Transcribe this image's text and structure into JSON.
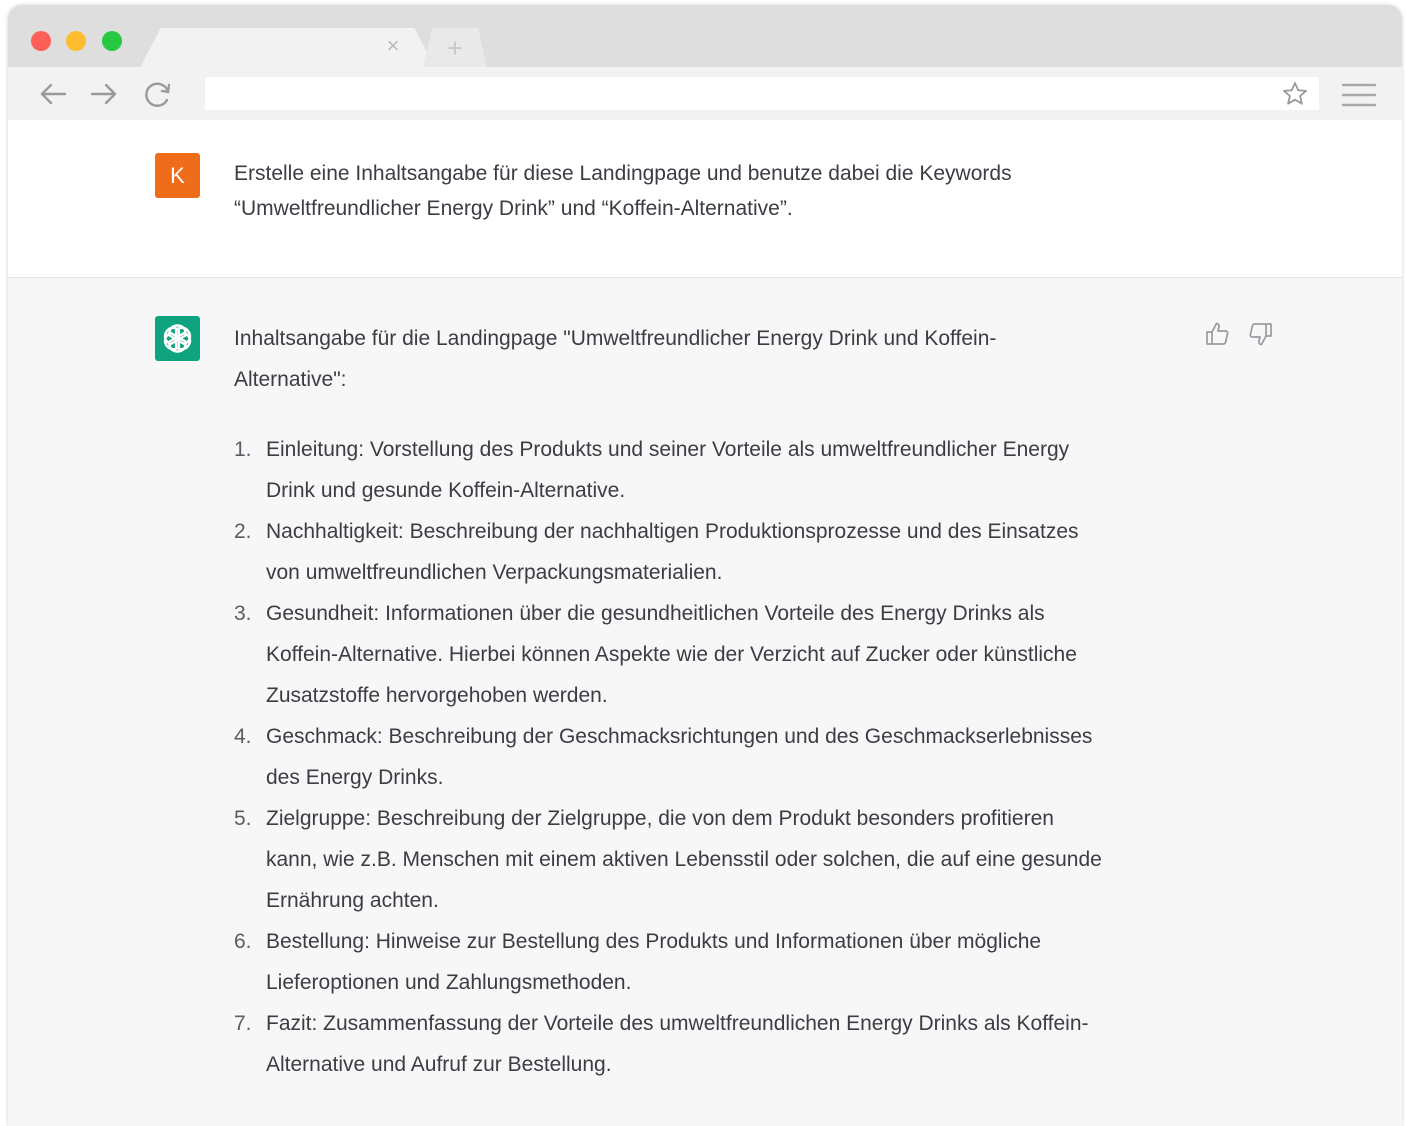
{
  "browser": {
    "tab_close_symbol": "×",
    "new_tab_symbol": "+",
    "address": ""
  },
  "chat": {
    "user": {
      "avatar_letter": "K",
      "avatar_color": "#ef6c1b",
      "message_line1": "Erstelle eine Inhaltsangabe für diese Landingpage und benutze dabei die Keywords",
      "message_line2": "“Umweltfreundlicher Energy Drink” und “Koffein-Alternative”."
    },
    "assistant": {
      "avatar_color": "#10a37f",
      "avatar_icon": "openai-logo-icon",
      "intro_line1": "Inhaltsangabe für die Landingpage \"Umweltfreundlicher Energy Drink und Koffein-",
      "intro_line2": "Alternative\":",
      "items": [
        {
          "num": "1.",
          "lines": [
            "Einleitung: Vorstellung des Produkts und seiner Vorteile als umweltfreundlicher Energy",
            "Drink und gesunde Koffein-Alternative."
          ]
        },
        {
          "num": "2.",
          "lines": [
            "Nachhaltigkeit: Beschreibung der nachhaltigen Produktionsprozesse und des Einsatzes",
            "von umweltfreundlichen Verpackungsmaterialien."
          ]
        },
        {
          "num": "3.",
          "lines": [
            "Gesundheit: Informationen über die gesundheitlichen Vorteile des Energy Drinks als",
            "Koffein-Alternative. Hierbei können Aspekte wie der Verzicht auf Zucker oder künstliche",
            "Zusatzstoffe hervorgehoben werden."
          ]
        },
        {
          "num": "4.",
          "lines": [
            "Geschmack: Beschreibung der Geschmacksrichtungen und des Geschmackserlebnisses",
            "des Energy Drinks."
          ]
        },
        {
          "num": "5.",
          "lines": [
            "Zielgruppe: Beschreibung der Zielgruppe, die von dem Produkt besonders profitieren",
            "kann, wie z.B. Menschen mit einem aktiven Lebensstil oder solchen, die auf eine gesunde",
            "Ernährung achten."
          ]
        },
        {
          "num": "6.",
          "lines": [
            "Bestellung: Hinweise zur Bestellung des Produkts und Informationen über mögliche",
            "Lieferoptionen und Zahlungsmethoden."
          ]
        },
        {
          "num": "7.",
          "lines": [
            "Fazit: Zusammenfassung der Vorteile des umweltfreundlichen Energy Drinks als Koffein-",
            "Alternative und Aufruf zur Bestellung."
          ]
        }
      ]
    }
  }
}
